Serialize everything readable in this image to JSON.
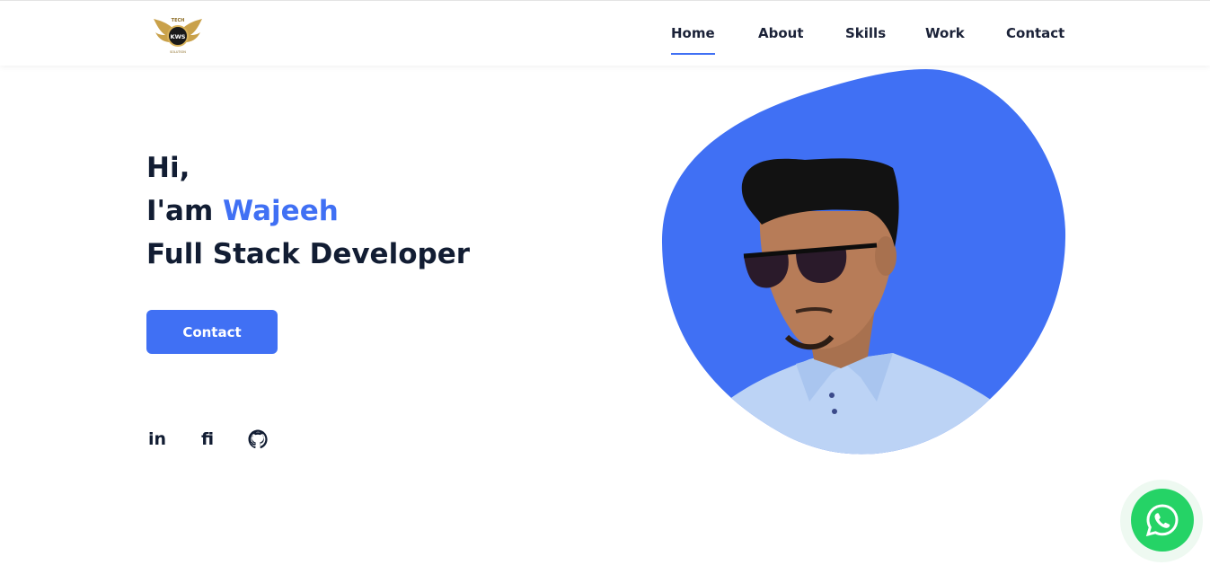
{
  "header": {
    "logo_icon": "kws-tech-winged-logo-icon",
    "logo_text_top": "TECH",
    "logo_text_center": "KWS",
    "logo_text_bottom": "SOLUTION"
  },
  "nav": {
    "items": [
      {
        "label": "Home",
        "active": true
      },
      {
        "label": "About",
        "active": false
      },
      {
        "label": "Skills",
        "active": false
      },
      {
        "label": "Work",
        "active": false
      },
      {
        "label": "Contact",
        "active": false
      }
    ]
  },
  "hero": {
    "greeting": "Hi,",
    "intro_prefix": "I'am ",
    "name": "Wajeeh",
    "role": "Full Stack Developer",
    "cta_label": "Contact",
    "portrait_icon": "profile-photo-blob"
  },
  "social": [
    {
      "icon": "linkedin-icon",
      "text": "in"
    },
    {
      "icon": "fiverr-icon",
      "text": "fi"
    },
    {
      "icon": "github-icon",
      "text": ""
    }
  ],
  "colors": {
    "accent": "#4070f4",
    "heading": "#121d33",
    "whatsapp": "#25d366"
  },
  "floating": {
    "whatsapp_icon": "whatsapp-icon"
  }
}
